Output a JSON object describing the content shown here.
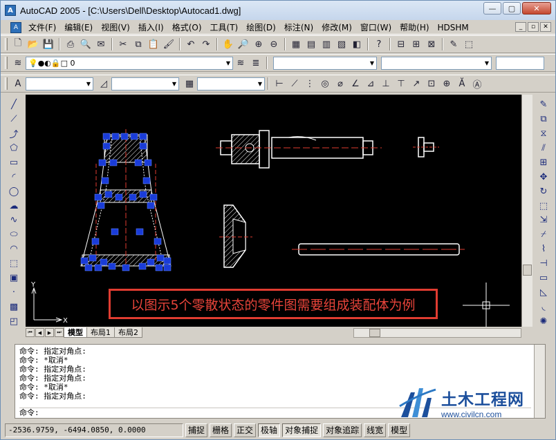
{
  "window": {
    "title": "AutoCAD 2005 - [C:\\Users\\Dell\\Desktop\\Autocad1.dwg]",
    "min": "—",
    "max": "▢",
    "close": "✕"
  },
  "menu": {
    "items": [
      "文件(F)",
      "编辑(E)",
      "视图(V)",
      "插入(I)",
      "格式(O)",
      "工具(T)",
      "绘图(D)",
      "标注(N)",
      "修改(M)",
      "窗口(W)",
      "帮助(H)",
      "HDSHM"
    ]
  },
  "layer_toolbar": {
    "layer_value": "0"
  },
  "canvas": {
    "caption": "以图示5个零散状态的零件图需要组成装配体为例",
    "ucs_x": "X",
    "ucs_y": "Y"
  },
  "tabs": {
    "items": [
      "模型",
      "布局1",
      "布局2"
    ],
    "active": 0
  },
  "command": {
    "lines": [
      "命令: 指定对角点:",
      "命令: *取消*",
      "命令: 指定对角点:",
      "命令: 指定对角点:",
      "命令: *取消*",
      "命令: 指定对角点:"
    ],
    "prompt": "命令:"
  },
  "status": {
    "coords": "-2536.9759, -6494.0850, 0.0000",
    "buttons": [
      {
        "label": "捕捉",
        "pressed": false
      },
      {
        "label": "栅格",
        "pressed": false
      },
      {
        "label": "正交",
        "pressed": false
      },
      {
        "label": "极轴",
        "pressed": true
      },
      {
        "label": "对象捕捉",
        "pressed": true
      },
      {
        "label": "对象追踪",
        "pressed": false
      },
      {
        "label": "线宽",
        "pressed": false
      },
      {
        "label": "模型",
        "pressed": false
      }
    ]
  },
  "watermark": {
    "name": "土木工程网",
    "url": "www.civilcn.com"
  }
}
